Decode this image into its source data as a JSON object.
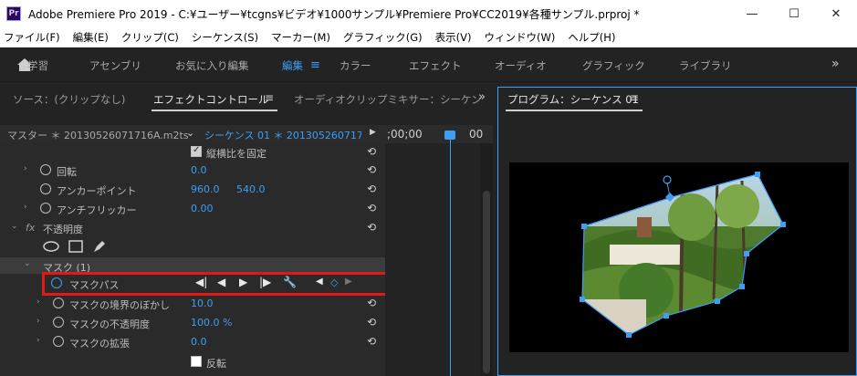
{
  "window": {
    "title": "Adobe Premiere Pro 2019 - C:¥ユーザー¥tcgns¥ビデオ¥1000サンプル¥Premiere Pro¥CC2019¥各種サンプル.prproj *",
    "app_icon": "Pr",
    "minimize": "—",
    "maximize": "☐",
    "close": "✕"
  },
  "menu": [
    "ファイル(F)",
    "編集(E)",
    "クリップ(C)",
    "シーケンス(S)",
    "マーカー(M)",
    "グラフィック(G)",
    "表示(V)",
    "ウィンドウ(W)",
    "ヘルプ(H)"
  ],
  "workspaces": {
    "home": "学習",
    "items": [
      "アセンブリ",
      "お気に入り編集",
      "編集",
      "カラー",
      "エフェクト",
      "オーディオ",
      "グラフィック",
      "ライブラリ"
    ],
    "active": "編集",
    "more": "»"
  },
  "left_panel": {
    "tabs": [
      "ソース：(クリップなし)",
      "エフェクトコントロール",
      "オーディオクリップミキサー：シーケン"
    ],
    "active_tab": "エフェクトコントロール",
    "menu_icon": "≡",
    "more": "»"
  },
  "master_row": {
    "master": "マスター ＊ 20130526071716A.m2ts",
    "sequence": "シーケンス 01 ＊ 2013052607171...",
    "timecode": ";00;00",
    "timecode2": "00"
  },
  "effects": {
    "uniform_scale_label": "縦横比を固定",
    "rotation_label": "回転",
    "rotation_value": "0.0",
    "anchor_label": "アンカーポイント",
    "anchor_x": "960.0",
    "anchor_y": "540.0",
    "antiflicker_label": "アンチフリッカー",
    "antiflicker_value": "0.00",
    "fx_icon": "fx",
    "opacity_label": "不透明度",
    "mask_label": "マスク (1)",
    "mask_path_label": "マスクパス",
    "mask_feather_label": "マスクの境界のぼかし",
    "mask_feather_value": "10.0",
    "mask_opacity_label": "マスクの不透明度",
    "mask_opacity_value": "100.0 %",
    "mask_expansion_label": "マスクの拡張",
    "mask_expansion_value": "0.0",
    "inverted_label": "反転"
  },
  "program": {
    "title": "プログラム：シーケンス 01",
    "menu_icon": "≡"
  },
  "colors": {
    "accent": "#3d9ef5",
    "highlight": "#e21919"
  }
}
